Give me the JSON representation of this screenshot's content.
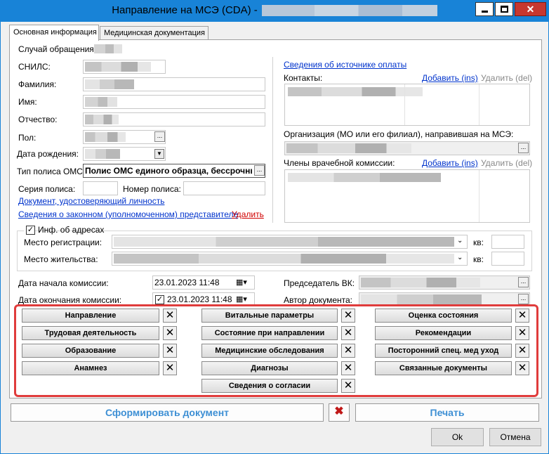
{
  "window": {
    "title": "Направление на МСЭ (CDA) -"
  },
  "tabs": [
    {
      "label": "Основная информация"
    },
    {
      "label": "Медицинская документация"
    }
  ],
  "left": {
    "case_label": "Случай обращения:",
    "snils_label": "СНИЛС:",
    "surname_label": "Фамилия:",
    "name_label": "Имя:",
    "patronymic_label": "Отчество:",
    "sex_label": "Пол:",
    "birthdate_label": "Дата рождения:",
    "policy_type_label": "Тип полиса ОМС:",
    "policy_type_value": "Полис ОМС единого образца, бессрочный",
    "policy_series_label": "Серия полиса:",
    "policy_number_label": "Номер полиса:",
    "identity_doc_link": "Документ, удостоверяющий личность",
    "legal_rep_link": "Сведения о законном (уполномоченном) представителе",
    "legal_rep_delete": "Удалить"
  },
  "right": {
    "payment_source_link": "Сведения об источнике оплаты",
    "contacts_label": "Контакты:",
    "add_label": "Добавить (ins)",
    "delete_label": "Удалить (del)",
    "org_label": "Организация (МО или его филиал), направившая на МСЭ:",
    "commission_members_label": "Члены врачебной комиссии:"
  },
  "address": {
    "checkbox_label": "Инф. об адресах",
    "checked": true,
    "registration_label": "Место регистрации:",
    "residence_label": "Место жительства:",
    "apt_label": "кв:"
  },
  "commission": {
    "start_label": "Дата начала комиссии:",
    "start_value": "23.01.2023 11:48",
    "end_label": "Дата окончания комиссии:",
    "end_value": "23.01.2023 11:48",
    "end_checked": true,
    "chair_label": "Председатель ВК:",
    "author_label": "Автор документа:"
  },
  "sections": {
    "col1": [
      "Направление",
      "Трудовая деятельность",
      "Образование",
      "Анамнез"
    ],
    "col2": [
      "Витальные параметры",
      "Состояние при направлении",
      "Медицинские обследования",
      "Диагнозы",
      "Сведения о согласии"
    ],
    "col3": [
      "Оценка состояния",
      "Рекомендации",
      "Посторонний спец. мед уход",
      "Связанные документы"
    ],
    "remove_symbol": "✕"
  },
  "footer": {
    "generate_label": "Сформировать документ",
    "print_label": "Печать",
    "ok_label": "Ok",
    "cancel_label": "Отмена"
  }
}
